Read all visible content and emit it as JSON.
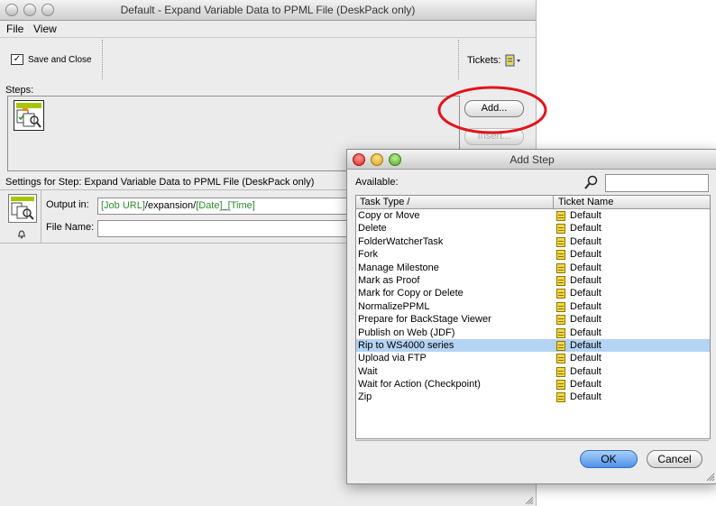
{
  "main_window": {
    "title": "Default - Expand Variable Data to PPML File (DeskPack only)",
    "menu": [
      "File",
      "View"
    ],
    "toolbar": {
      "save_close_label": "Save and Close",
      "tickets_label": "Tickets:"
    },
    "steps_label": "Steps:",
    "add_button": "Add...",
    "insert_button": "Insert...",
    "settings_label": "Settings for Step: Expand Variable Data to PPML File (DeskPack only)",
    "output_label": "Output in:",
    "output_value": {
      "part1": "[Job URL]",
      "part2": "/expansion/",
      "part3": "[Date]",
      "part4": "_",
      "part5": "[Time]"
    },
    "file_name_label": "File Name:",
    "file_name_value": ""
  },
  "dialog": {
    "title": "Add Step",
    "available_label": "Available:",
    "search_value": "",
    "columns": {
      "task": "Task Type /",
      "ticket": "Ticket Name"
    },
    "rows": [
      {
        "task": "Copy or Move",
        "ticket": "Default",
        "selected": false
      },
      {
        "task": "Delete",
        "ticket": "Default",
        "selected": false
      },
      {
        "task": "FolderWatcherTask",
        "ticket": "Default",
        "selected": false
      },
      {
        "task": "Fork",
        "ticket": "Default",
        "selected": false
      },
      {
        "task": "Manage Milestone",
        "ticket": "Default",
        "selected": false
      },
      {
        "task": "Mark as Proof",
        "ticket": "Default",
        "selected": false
      },
      {
        "task": "Mark for Copy or Delete",
        "ticket": "Default",
        "selected": false
      },
      {
        "task": "NormalizePPML",
        "ticket": "Default",
        "selected": false
      },
      {
        "task": "Prepare for BackStage Viewer",
        "ticket": "Default",
        "selected": false
      },
      {
        "task": "Publish on Web (JDF)",
        "ticket": "Default",
        "selected": false
      },
      {
        "task": "Rip to WS4000 series",
        "ticket": "Default",
        "selected": true
      },
      {
        "task": "Upload via FTP",
        "ticket": "Default",
        "selected": false
      },
      {
        "task": "Wait",
        "ticket": "Default",
        "selected": false
      },
      {
        "task": "Wait for Action (Checkpoint)",
        "ticket": "Default",
        "selected": false
      },
      {
        "task": "Zip",
        "ticket": "Default",
        "selected": false
      }
    ],
    "ok_button": "OK",
    "cancel_button": "Cancel"
  },
  "colors": {
    "annotation_red": "#e0141c",
    "selection": "#b5d3f3",
    "ok_blue": "#5c9ded",
    "token_green": "#2f8b2f"
  }
}
